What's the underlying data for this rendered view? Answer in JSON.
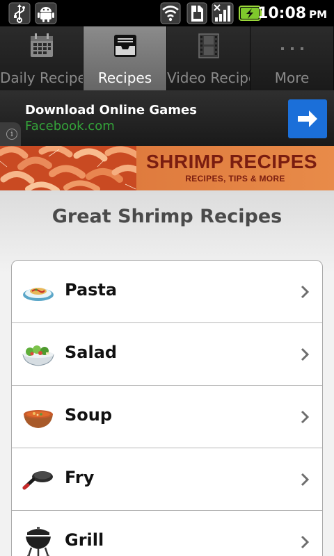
{
  "status_bar": {
    "time": "10:08",
    "ampm": "PM",
    "icons": [
      "usb-icon",
      "android-debug-icon",
      "wifi-icon",
      "sim-card-icon",
      "signal-icon",
      "battery-charging-icon"
    ]
  },
  "tabs": [
    {
      "label": "Daily Recipes",
      "icon": "calendar-icon",
      "active": false
    },
    {
      "label": "Recipes",
      "icon": "inbox-tray-icon",
      "active": true
    },
    {
      "label": "Video Recipe",
      "icon": "film-strip-icon",
      "active": false
    },
    {
      "label": "More",
      "icon": "ellipsis-icon",
      "active": false
    }
  ],
  "ad": {
    "title": "Download Online Games",
    "subtitle": "Facebook.com",
    "info_glyph": "i",
    "button_icon": "arrow-right-icon",
    "accent_color": "#1b6fd9",
    "subtitle_color": "#34a43a"
  },
  "header_banner": {
    "title": "SHRIMP RECIPES",
    "subtitle": "RECIPES, TIPS & MORE"
  },
  "page": {
    "title": "Great Shrimp Recipes"
  },
  "recipes": [
    {
      "label": "Pasta",
      "icon": "pasta-plate-icon"
    },
    {
      "label": "Salad",
      "icon": "salad-bowl-icon"
    },
    {
      "label": "Soup",
      "icon": "soup-bowl-icon"
    },
    {
      "label": "Fry",
      "icon": "frying-pan-icon"
    },
    {
      "label": "Grill",
      "icon": "grill-icon"
    }
  ]
}
